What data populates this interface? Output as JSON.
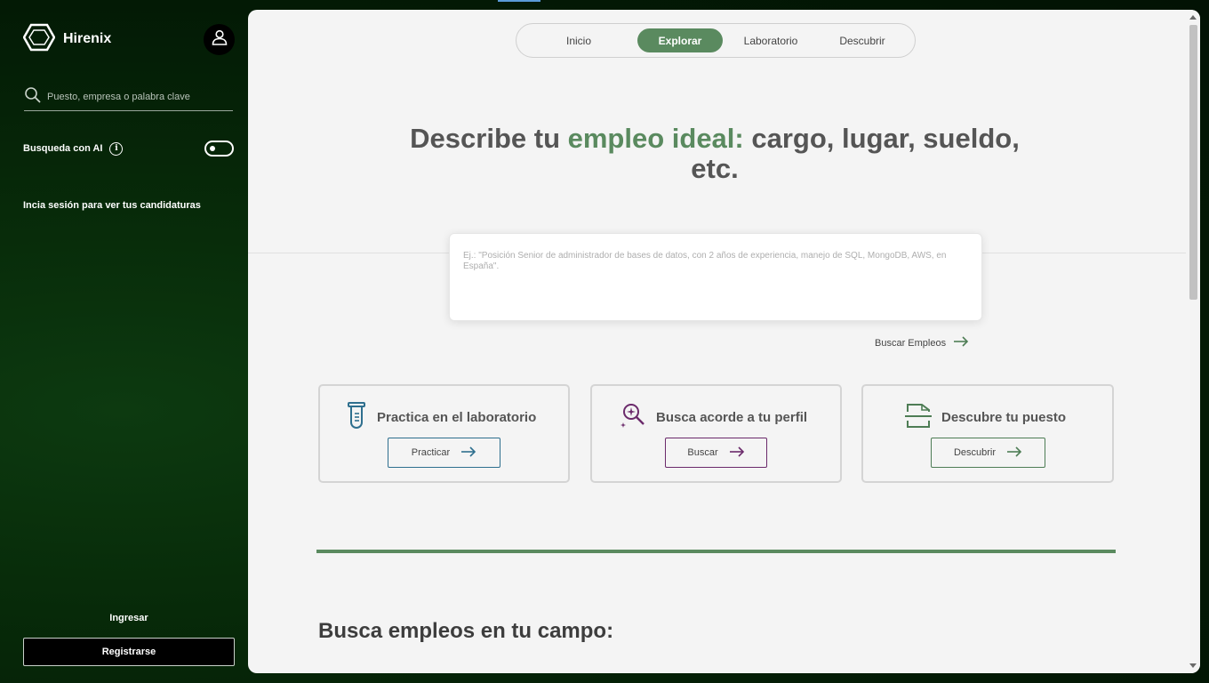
{
  "sidebar": {
    "brand_name": "Hirenix",
    "search_placeholder": "Puesto, empresa o palabra clave",
    "ai_label": "Busqueda con AI",
    "ai_toggle_on": false,
    "login_hint": "Incia sesión para ver tus candidaturas",
    "ingresar_label": "Ingresar",
    "registrarse_label": "Registrarse"
  },
  "nav": {
    "tabs": [
      {
        "label": "Inicio",
        "active": false
      },
      {
        "label": "Explorar",
        "active": true
      },
      {
        "label": "Laboratorio",
        "active": false
      },
      {
        "label": "Descubrir",
        "active": false
      }
    ]
  },
  "hero": {
    "headline_part1": "Describe tu ",
    "headline_accent": "empleo ideal:",
    "headline_part2": " cargo, lugar, sueldo, etc.",
    "query_placeholder": "Ej.: \"Posición Senior de administrador de bases de datos, con 2 años de experiencia, manejo de SQL, MongoDB, AWS, en España\".",
    "search_jobs_label": "Buscar Empleos"
  },
  "cards": [
    {
      "title": "Practica en el laboratorio",
      "button_label": "Practicar",
      "icon": "test-tube-icon",
      "color": "#2e6f8e"
    },
    {
      "title": "Busca acorde a tu perfil",
      "button_label": "Buscar",
      "icon": "magnify-sparkle-icon",
      "color": "#6b2a6b"
    },
    {
      "title": "Descubre tu puesto",
      "button_label": "Descubrir",
      "icon": "document-scan-icon",
      "color": "#4e7d55"
    }
  ],
  "section_title": "Busca empleos en tu campo:",
  "colors": {
    "accent": "#5a8a5f",
    "sidebar_bg": "#072a09",
    "main_bg": "#f4f4f4",
    "text_dark": "#555555"
  }
}
